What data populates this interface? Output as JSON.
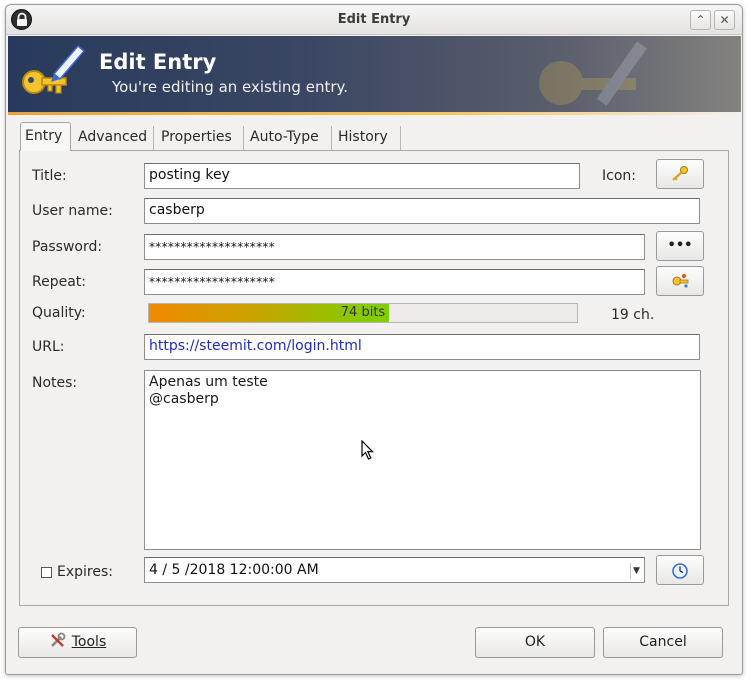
{
  "window": {
    "title": "Edit Entry"
  },
  "banner": {
    "heading": "Edit Entry",
    "subheading": "You're editing an existing entry."
  },
  "tabs": [
    {
      "label": "Entry",
      "active": true
    },
    {
      "label": "Advanced",
      "active": false
    },
    {
      "label": "Properties",
      "active": false
    },
    {
      "label": "Auto-Type",
      "active": false
    },
    {
      "label": "History",
      "active": false
    }
  ],
  "form": {
    "title_label": "Title:",
    "title_value": "posting key",
    "icon_label": "Icon:",
    "username_label": "User name:",
    "username_value": "casberp",
    "password_label": "Password:",
    "password_value": "********************",
    "repeat_label": "Repeat:",
    "repeat_value": "********************",
    "quality_label": "Quality:",
    "quality_text": "74 bits",
    "quality_fraction": 0.56,
    "char_count": "19 ch.",
    "url_label": "URL:",
    "url_value": "https://steemit.com/login.html",
    "notes_label": "Notes:",
    "notes_lines": [
      "Apenas um teste",
      "@casberp"
    ],
    "expires_label": "Expires:",
    "expires_checked": false,
    "expires_value": "4 / 5 /2018 12:00:00 AM"
  },
  "icons": {
    "lock": "lock-icon",
    "key": "key-icon",
    "dots": "show-password-icon",
    "generator": "password-generator-icon",
    "clock": "clock-icon",
    "tools": "tools-icon"
  },
  "buttons": {
    "tools_label": "Tools",
    "ok_label": "OK",
    "cancel_label": "Cancel",
    "show_password_label": "•••"
  },
  "colors": {
    "banner_start": "#283a5c",
    "banner_end": "#83827f",
    "url_text": "#1f2bbf",
    "quality_start": "#f08a00",
    "quality_end": "#7ed100"
  }
}
